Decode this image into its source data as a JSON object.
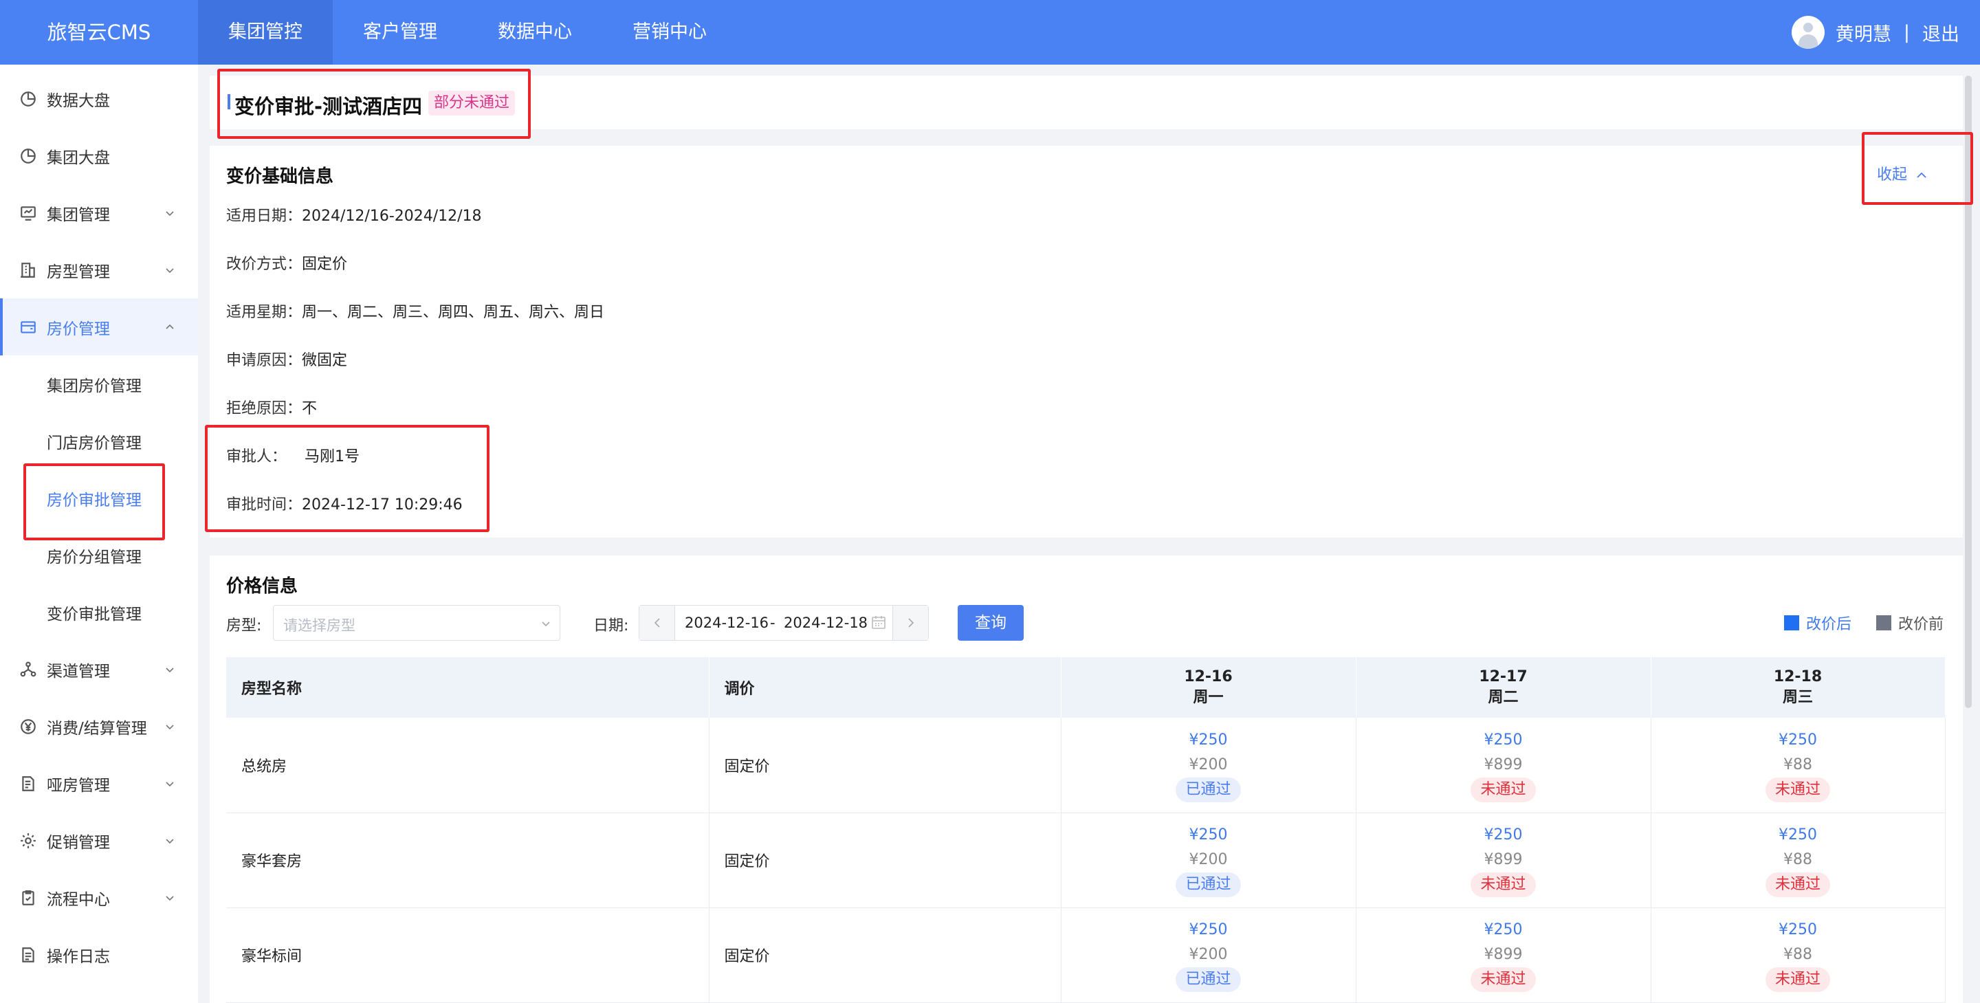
{
  "app": {
    "brand": "旅智云CMS"
  },
  "topnav": [
    {
      "label": "集团管控",
      "active": true
    },
    {
      "label": "客户管理",
      "active": false
    },
    {
      "label": "数据中心",
      "active": false
    },
    {
      "label": "营销中心",
      "active": false
    }
  ],
  "user": {
    "name": "黄明慧",
    "separator": "|",
    "logout": "退出"
  },
  "sidebar": {
    "items": [
      {
        "label": "数据大盘",
        "icon": "pie-chart-icon"
      },
      {
        "label": "集团大盘",
        "icon": "pie-chart-icon"
      },
      {
        "label": "集团管理",
        "icon": "monitor-icon"
      },
      {
        "label": "房型管理",
        "icon": "building-icon"
      },
      {
        "label": "房价管理",
        "icon": "wallet-icon"
      },
      {
        "label": "集团房价管理"
      },
      {
        "label": "门店房价管理"
      },
      {
        "label": "房价审批管理"
      },
      {
        "label": "房价分组管理"
      },
      {
        "label": "变价审批管理"
      },
      {
        "label": "渠道管理",
        "icon": "network-icon"
      },
      {
        "label": "消费/结算管理",
        "icon": "yen-icon"
      },
      {
        "label": "哑房管理",
        "icon": "document-icon"
      },
      {
        "label": "促销管理",
        "icon": "gear-icon"
      },
      {
        "label": "流程中心",
        "icon": "clipboard-icon"
      },
      {
        "label": "操作日志",
        "icon": "log-icon"
      }
    ]
  },
  "header": {
    "title": "变价审批-测试酒店四",
    "status": "部分未通过"
  },
  "info": {
    "section_title": "变价基础信息",
    "collapse_label": "收起",
    "rows": [
      {
        "key": "适用日期：",
        "value": "2024/12/16-2024/12/18"
      },
      {
        "key": "改价方式：",
        "value": "固定价"
      },
      {
        "key": "适用星期：",
        "value": "周一、周二、周三、周四、周五、周六、周日"
      },
      {
        "key": "申请原因：",
        "value": "微固定"
      },
      {
        "key": "拒绝原因：",
        "value": "不"
      },
      {
        "key": "审批人：",
        "value": "马刚1号"
      },
      {
        "key": "审批时间：",
        "value": "2024-12-17 10:29:46"
      }
    ]
  },
  "price": {
    "section_title": "价格信息",
    "room_label": "房型:",
    "room_placeholder": "请选择房型",
    "date_label": "日期:",
    "date_start": "2024-12-16",
    "date_dash": "-",
    "date_end": "2024-12-18",
    "query_label": "查询",
    "legend_after": "改价后",
    "legend_before": "改价前",
    "colors": {
      "after": "#1f6ff2",
      "before": "#6f7585"
    },
    "columns": {
      "room": "房型名称",
      "adjust": "调价"
    },
    "days": [
      {
        "date": "12-16",
        "weekday": "周一"
      },
      {
        "date": "12-17",
        "weekday": "周二"
      },
      {
        "date": "12-18",
        "weekday": "周三"
      }
    ],
    "rows": [
      {
        "name": "总统房",
        "adjust": "固定价",
        "cells": [
          {
            "after": "¥250",
            "before": "¥200",
            "status": "已通过"
          },
          {
            "after": "¥250",
            "before": "¥899",
            "status": "未通过"
          },
          {
            "after": "¥250",
            "before": "¥88",
            "status": "未通过"
          }
        ]
      },
      {
        "name": "豪华套房",
        "adjust": "固定价",
        "cells": [
          {
            "after": "¥250",
            "before": "¥200",
            "status": "已通过"
          },
          {
            "after": "¥250",
            "before": "¥899",
            "status": "未通过"
          },
          {
            "after": "¥250",
            "before": "¥88",
            "status": "未通过"
          }
        ]
      },
      {
        "name": "豪华标间",
        "adjust": "固定价",
        "cells": [
          {
            "after": "¥250",
            "before": "¥200",
            "status": "已通过"
          },
          {
            "after": "¥250",
            "before": "¥899",
            "status": "未通过"
          },
          {
            "after": "¥250",
            "before": "¥88",
            "status": "未通过"
          }
        ]
      }
    ]
  }
}
